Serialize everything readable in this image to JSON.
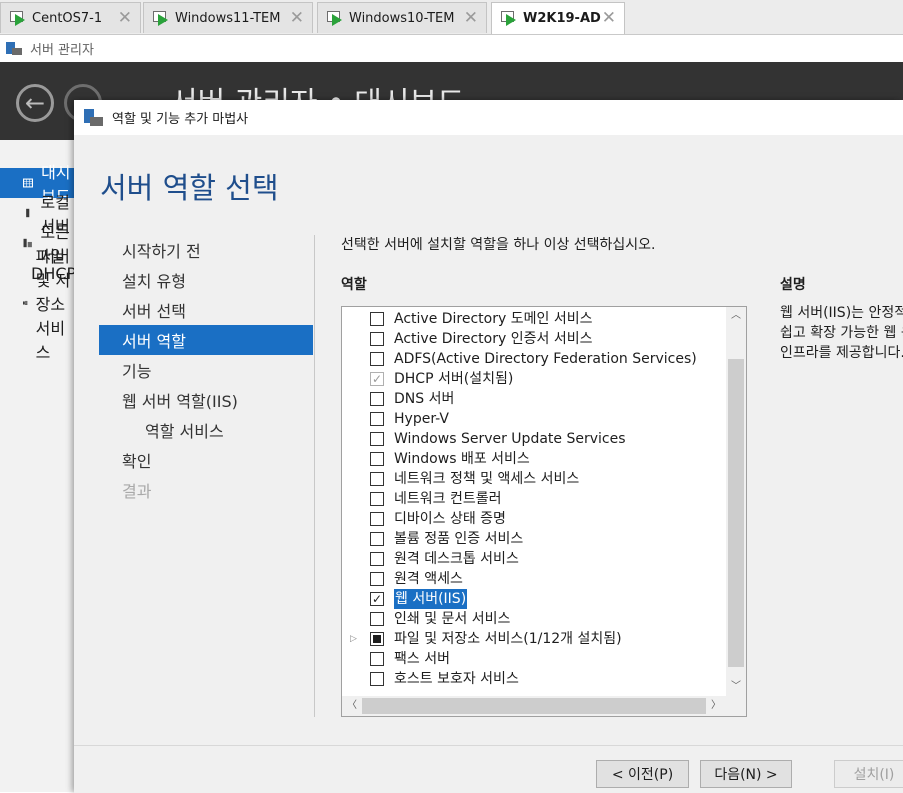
{
  "vm_tabs": [
    {
      "label": "CentOS7-1",
      "close": "✕"
    },
    {
      "label": "Windows11-TEM",
      "close": "✕"
    },
    {
      "label": "Windows10-TEM",
      "close": "✕"
    },
    {
      "label": "W2K19-AD",
      "close": "✕"
    }
  ],
  "server_manager": {
    "title": "서버 관리자",
    "header_title": "서버 관리자 • 대시보드",
    "nav": [
      "대시보드",
      "로컬 서버",
      "모든 서버",
      "DHCP",
      "파일 및 저장소 서비스"
    ]
  },
  "wizard": {
    "title": "역할 및 기능 추가 마법사",
    "heading": "서버 역할 선택",
    "steps": [
      "시작하기 전",
      "설치 유형",
      "서버 선택",
      "서버 역할",
      "기능",
      "웹 서버 역할(IIS)",
      "역할 서비스",
      "확인",
      "결과"
    ],
    "instruction": "선택한 서버에 설치할 역할을 하나 이상 선택하십시오.",
    "roles_header": "역할",
    "description_header": "설명",
    "description_lines": [
      "웹 서버(IIS)는 안정적이고",
      "쉽고 확장 가능한 웹 응용 프로그램",
      "인프라를 제공합니다."
    ],
    "roles": [
      {
        "label": "Active Directory 도메인 서비스",
        "state": "unchecked"
      },
      {
        "label": "Active Directory 인증서 서비스",
        "state": "unchecked"
      },
      {
        "label": "ADFS(Active Directory Federation Services)",
        "state": "unchecked"
      },
      {
        "label": "DHCP 서버(설치됨)",
        "state": "checked-disabled"
      },
      {
        "label": "DNS 서버",
        "state": "unchecked"
      },
      {
        "label": "Hyper-V",
        "state": "unchecked"
      },
      {
        "label": "Windows Server Update Services",
        "state": "unchecked"
      },
      {
        "label": "Windows 배포 서비스",
        "state": "unchecked"
      },
      {
        "label": "네트워크 정책 및 액세스 서비스",
        "state": "unchecked"
      },
      {
        "label": "네트워크 컨트롤러",
        "state": "unchecked"
      },
      {
        "label": "디바이스 상태 증명",
        "state": "unchecked"
      },
      {
        "label": "볼륨 정품 인증 서비스",
        "state": "unchecked"
      },
      {
        "label": "원격 데스크톱 서비스",
        "state": "unchecked"
      },
      {
        "label": "원격 액세스",
        "state": "unchecked"
      },
      {
        "label": "웹 서버(IIS)",
        "state": "checked",
        "highlighted": true
      },
      {
        "label": "인쇄 및 문서 서비스",
        "state": "unchecked"
      },
      {
        "label": "파일 및 저장소 서비스(1/12개 설치됨)",
        "state": "partial",
        "expandable": true
      },
      {
        "label": "팩스 서버",
        "state": "unchecked"
      },
      {
        "label": "호스트 보호자 서비스",
        "state": "unchecked"
      }
    ],
    "buttons": {
      "previous": "< 이전(P)",
      "next": "다음(N) >",
      "install": "설치(I)"
    }
  }
}
